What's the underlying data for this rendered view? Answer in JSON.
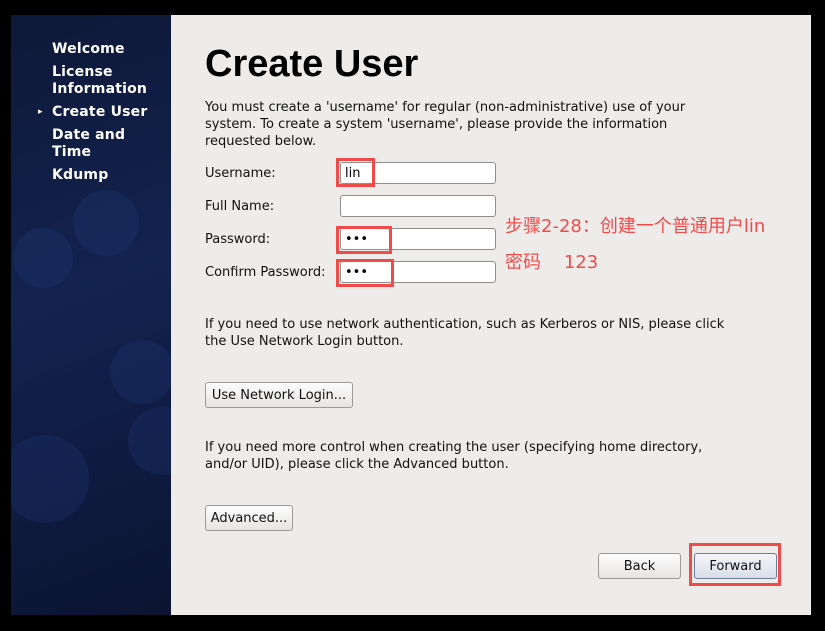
{
  "sidebar": {
    "items": [
      {
        "label": "Welcome",
        "active": false
      },
      {
        "label": "License Information",
        "active": false
      },
      {
        "label": "Create User",
        "active": true
      },
      {
        "label": "Date and Time",
        "active": false
      },
      {
        "label": "Kdump",
        "active": false
      }
    ],
    "active_marker": "▸"
  },
  "main": {
    "title": "Create User",
    "intro": "You must create a 'username' for regular (non-administrative) use of your system.  To create a system 'username', please provide the information requested below.",
    "form": {
      "username_label": "Username:",
      "username_value": "lin",
      "fullname_label": "Full Name:",
      "fullname_value": "",
      "password_label": "Password:",
      "password_value": "•••",
      "confirm_label": "Confirm Password:",
      "confirm_value": "•••"
    },
    "network_text": "If you need to use network authentication, such as Kerberos or NIS, please click the Use Network Login button.",
    "network_button": "Use Network Login...",
    "advanced_text": "If you need more control when creating the user (specifying home directory, and/or UID), please click the Advanced button.",
    "advanced_button": "Advanced...",
    "back_button": "Back",
    "forward_button": "Forward"
  },
  "annotation": {
    "line1": "步骤2-28：创建一个普通用户lin",
    "line2": "密码    123",
    "color": "#f04b4b"
  }
}
